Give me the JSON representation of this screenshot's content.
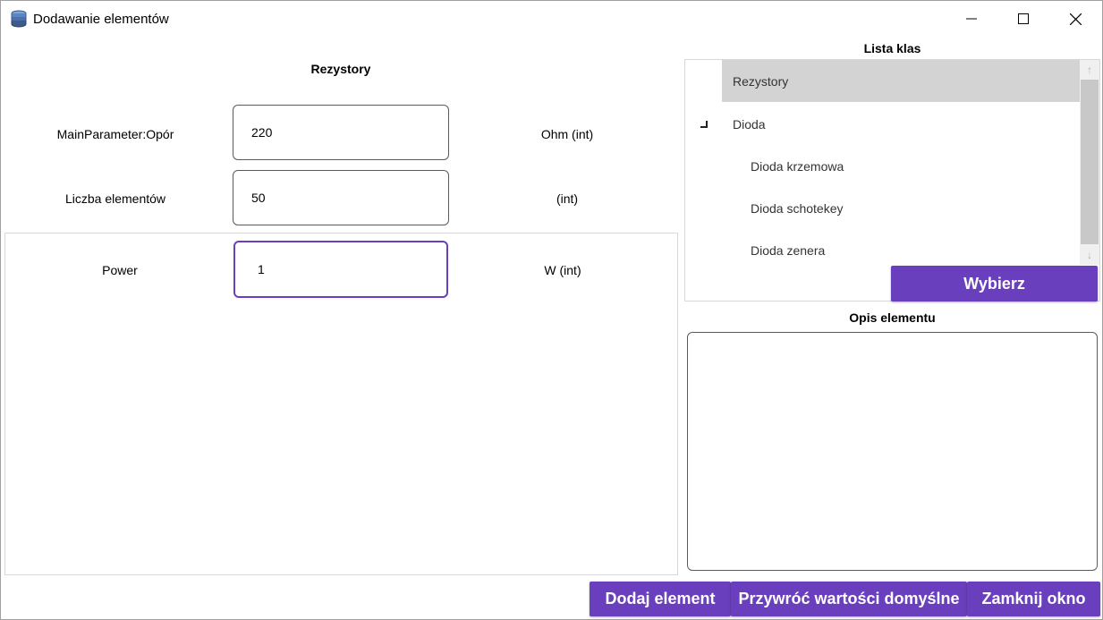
{
  "window": {
    "title": "Dodawanie elementów"
  },
  "left": {
    "section_title": "Rezystory",
    "params": [
      {
        "label": "MainParameter:Opór",
        "value": "220",
        "unit": "Ohm (int)"
      },
      {
        "label": "Liczba elementów",
        "value": "50",
        "unit": "(int)"
      },
      {
        "label": "Power",
        "value": "1",
        "unit": "W (int)"
      }
    ]
  },
  "right": {
    "class_list_title": "Lista klas",
    "class_items": [
      {
        "label": "Rezystory"
      },
      {
        "label": "Dioda"
      },
      {
        "label": "Dioda krzemowa"
      },
      {
        "label": "Dioda schotekey"
      },
      {
        "label": "Dioda zenera"
      }
    ],
    "choose_button": "Wybierz",
    "description_title": "Opis elementu",
    "description_value": ""
  },
  "footer": {
    "add_button": "Dodaj element",
    "reset_button": "Przywróć wartości domyślne",
    "close_button": "Zamknij okno"
  },
  "colors": {
    "accent": "#6a3fbd",
    "selected_row": "#d3d3d3"
  }
}
